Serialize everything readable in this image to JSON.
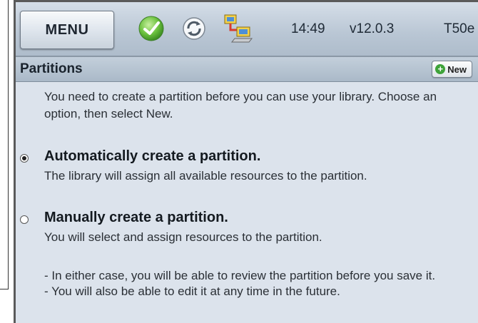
{
  "header": {
    "menu_label": "MENU",
    "clock": "14:49",
    "version": "v12.0.3",
    "model": "T50e",
    "icons": [
      "checkmark-status-icon",
      "sync-icon",
      "network-computers-icon"
    ]
  },
  "panel": {
    "title": "Partitions",
    "new_button_label": "New",
    "intro": "You need to create a partition before you can use your library. Choose an option, then select New.",
    "options": [
      {
        "title": "Automatically create a partition.",
        "description": "The library will assign all available resources to the partition.",
        "selected": true
      },
      {
        "title": "Manually create a partition.",
        "description": "You will select and assign resources to the partition.",
        "selected": false
      }
    ],
    "notes": [
      "- In either case, you will be able to review the partition before you save it.",
      "- You will also be able to edit it at any time in the future."
    ]
  },
  "colors": {
    "accent_green": "#5cb83a",
    "header_bg": "#c2cedb",
    "content_bg": "#dce3ec"
  }
}
